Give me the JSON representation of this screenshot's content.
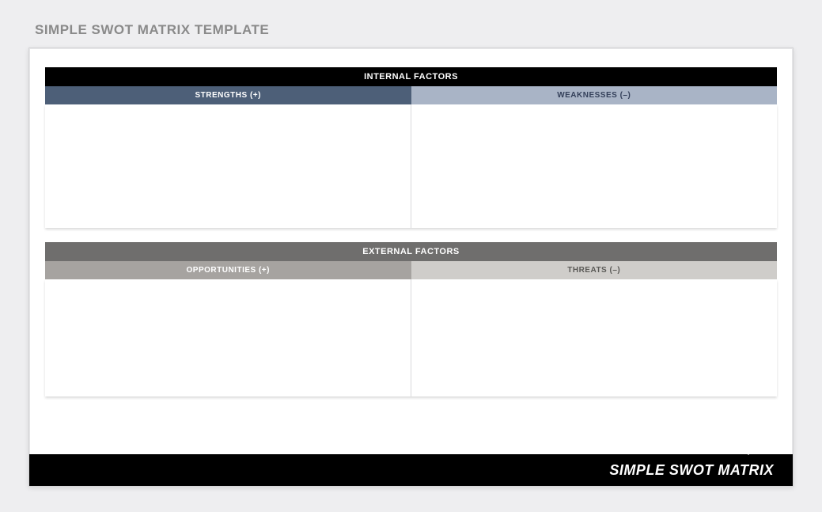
{
  "title": "SIMPLE SWOT MATRIX TEMPLATE",
  "internal": {
    "header": "INTERNAL FACTORS",
    "strengths_label": "STRENGTHS (+)",
    "weaknesses_label": "WEAKNESSES (–)"
  },
  "external": {
    "header": "EXTERNAL FACTORS",
    "opportunities_label": "OPPORTUNITIES (+)",
    "threats_label": "THREATS (–)"
  },
  "footer": {
    "label": "SIMPLE SWOT MATRIX"
  }
}
